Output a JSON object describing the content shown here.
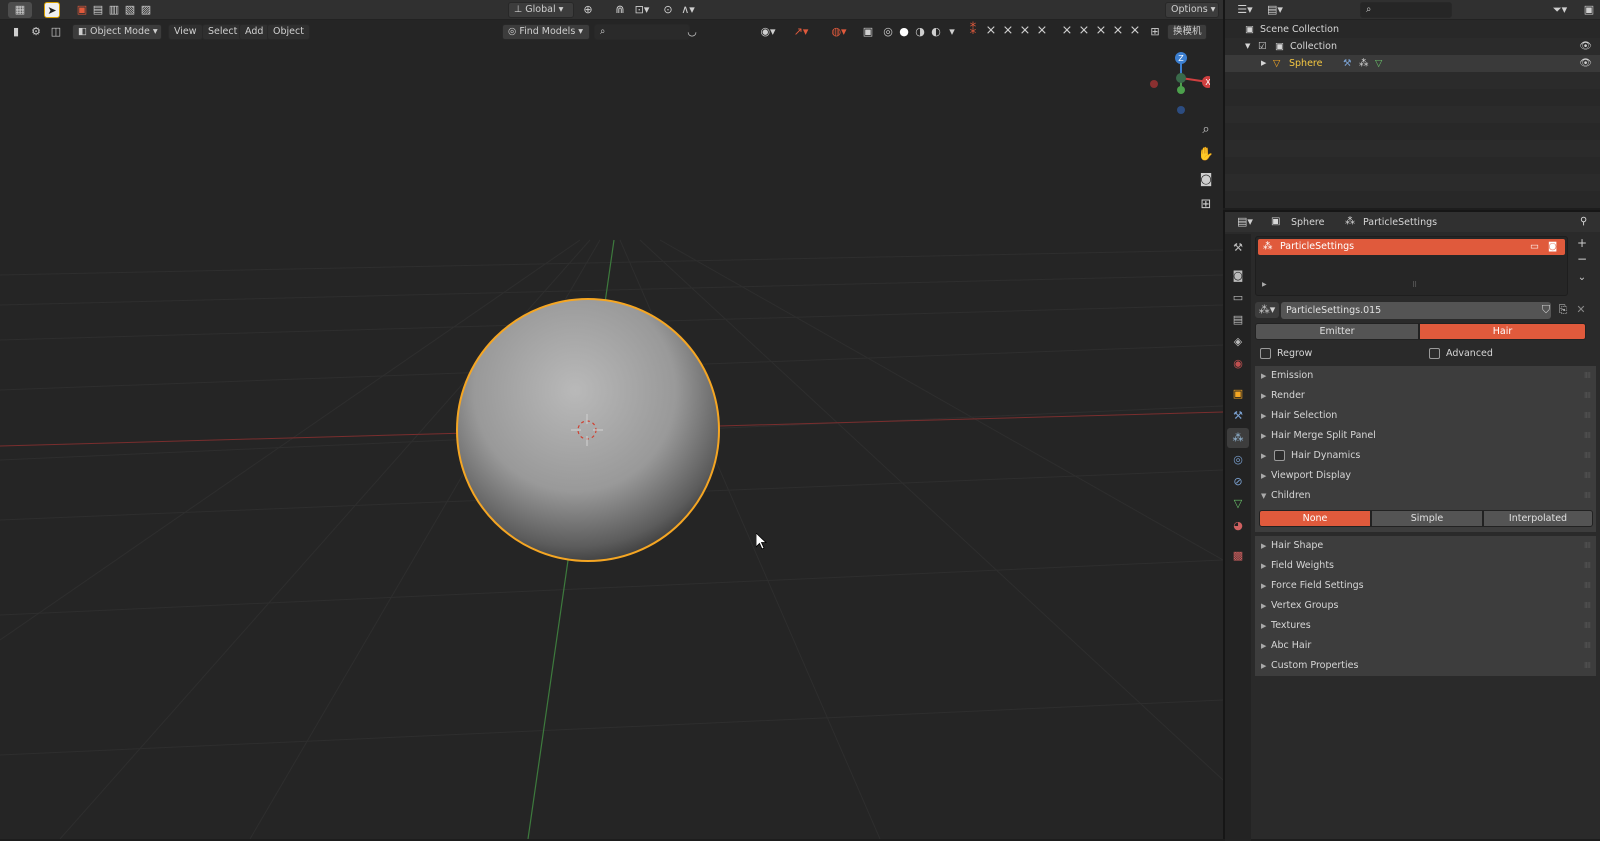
{
  "viewport": {
    "global_label": "Global",
    "options_label": "Options",
    "mode_label": "Object Mode",
    "menus": [
      "View",
      "Select",
      "Add",
      "Object"
    ],
    "find_models_label": "Find Models",
    "switch_label": "换模机",
    "gizmo": {
      "z": "Z",
      "x": "X"
    }
  },
  "outliner": {
    "rows": [
      {
        "label": "Scene Collection"
      },
      {
        "label": "Collection"
      },
      {
        "label": "Sphere"
      }
    ]
  },
  "properties": {
    "breadcrumb": {
      "object": "Sphere",
      "settings": "ParticleSettings"
    },
    "particle_system_name": "ParticleSettings",
    "settings_datablock": "ParticleSettings.015",
    "type_segments": [
      {
        "label": "Emitter",
        "active": false
      },
      {
        "label": "Hair",
        "active": true
      }
    ],
    "regrow_label": "Regrow",
    "advanced_label": "Advanced",
    "panels_top": [
      {
        "label": "Emission"
      },
      {
        "label": "Render"
      },
      {
        "label": "Hair Selection"
      },
      {
        "label": "Hair Merge Split Panel"
      },
      {
        "label": "Hair Dynamics"
      },
      {
        "label": "Viewport Display"
      },
      {
        "label": "Children"
      }
    ],
    "children_segments": [
      {
        "label": "None",
        "active": true
      },
      {
        "label": "Simple",
        "active": false
      },
      {
        "label": "Interpolated",
        "active": false
      }
    ],
    "panels_bottom": [
      {
        "label": "Hair Shape"
      },
      {
        "label": "Field Weights"
      },
      {
        "label": "Force Field Settings"
      },
      {
        "label": "Vertex Groups"
      },
      {
        "label": "Textures"
      },
      {
        "label": "Abc Hair"
      },
      {
        "label": "Custom Properties"
      }
    ]
  },
  "colors": {
    "accent": "#e05a3c",
    "selection_outline": "#f5a623",
    "viewport_bg": "#252525",
    "panel_bg": "#3d3d3d"
  }
}
